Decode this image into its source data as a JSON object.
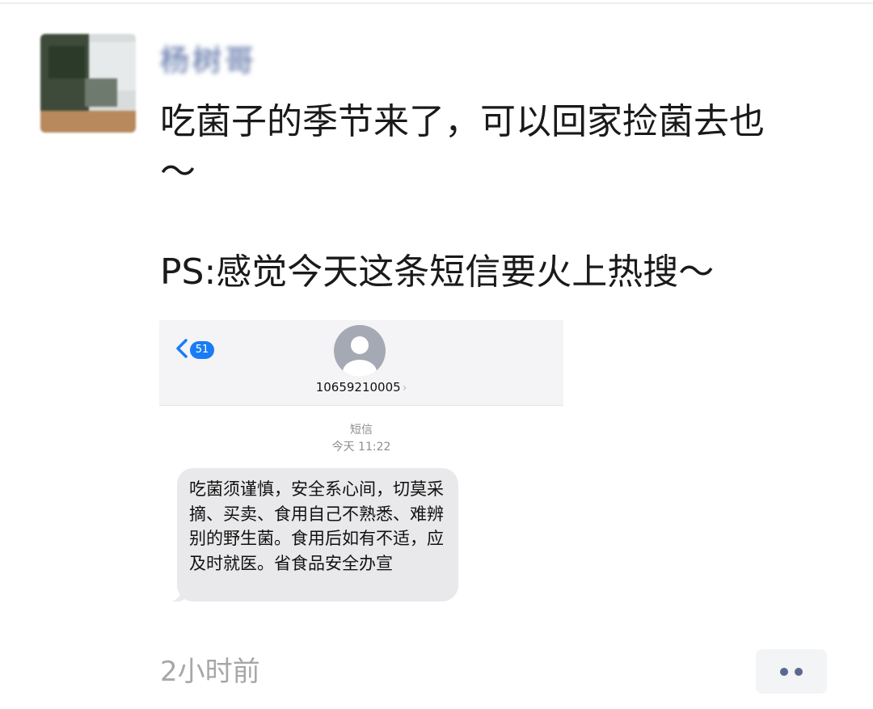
{
  "post": {
    "author_name": "杨树哥",
    "text": "吃菌子的季节来了，可以回家捡菌去也\n～\n\nPS:感觉今天这条短信要火上热搜～",
    "time": "2小时前"
  },
  "sms_screenshot": {
    "unread_count": "51",
    "contact_number": "10659210005",
    "contact_chevron": "›",
    "message_kind": "短信",
    "message_time": "今天 11:22",
    "message_text": "吃菌须谨慎，安全系心间，切莫采摘、买卖、食用自己不熟悉、难辨别的野生菌。食用后如有不适，应及时就医。省食品安全办宣"
  },
  "colors": {
    "badge_blue": "#1a7cf5",
    "bubble_gray": "#e9e9eb",
    "time_gray": "#a7a7a7",
    "more_dots": "#5a6a8e"
  },
  "icons": {
    "back": "chevron-left-icon",
    "contact": "person-avatar-icon",
    "more": "more-dots-icon"
  }
}
